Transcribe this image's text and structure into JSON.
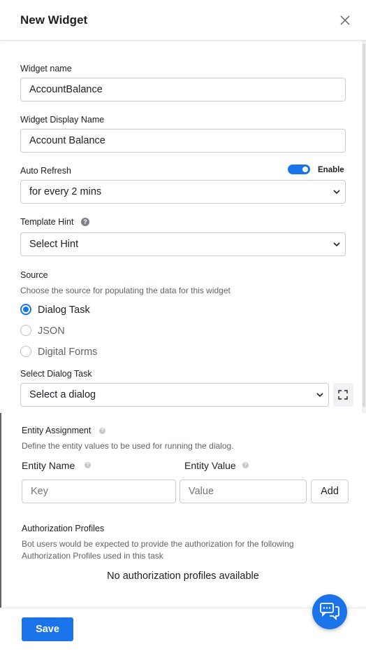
{
  "header": {
    "title": "New Widget"
  },
  "form": {
    "widget_name": {
      "label": "Widget name",
      "value": "AccountBalance"
    },
    "display_name": {
      "label": "Widget Display Name",
      "value": "Account Balance"
    },
    "auto_refresh": {
      "label": "Auto Refresh",
      "toggle_label": "Enable",
      "enabled": true,
      "selected": "for every 2 mins"
    },
    "template_hint": {
      "label": "Template Hint",
      "selected": "Select Hint"
    },
    "source": {
      "label": "Source",
      "description": "Choose the source for populating the data for this widget",
      "options": [
        {
          "label": "Dialog Task",
          "checked": true
        },
        {
          "label": "JSON",
          "checked": false
        },
        {
          "label": "Digital Forms",
          "checked": false
        }
      ]
    },
    "dialog_task": {
      "label": "Select Dialog Task",
      "selected": "Select a dialog"
    },
    "entity_assignment": {
      "label": "Entity Assignment",
      "description": "Define the entity values to be used for running the dialog.",
      "name_label": "Entity Name",
      "value_label": "Entity Value",
      "key_placeholder": "Key",
      "value_placeholder": "Value",
      "add_label": "Add"
    },
    "authorization": {
      "label": "Authorization Profiles",
      "description_line1": "Bot users would be expected to provide the authorization for the following",
      "description_line2": "Authorization Profiles used in this task",
      "empty_text": "No authorization profiles available"
    }
  },
  "footer": {
    "save_label": "Save"
  },
  "colors": {
    "accent": "#1a73e8",
    "border": "#c9ccd1"
  }
}
